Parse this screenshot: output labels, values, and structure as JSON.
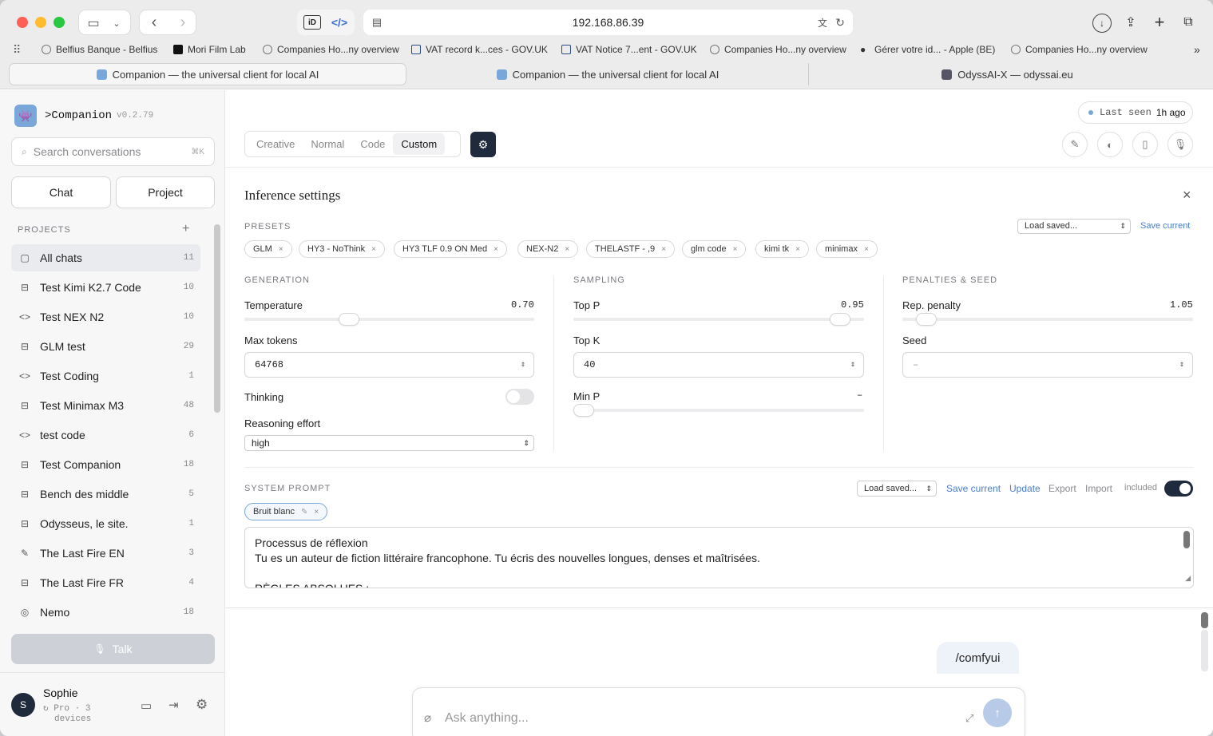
{
  "browser": {
    "url": "192.168.86.39",
    "bookmarks": [
      "Belfius Banque - Belfius",
      "Mori Film Lab",
      "Companies Ho...ny overview",
      "VAT record k...ces - GOV.UK",
      "VAT Notice 7...ent - GOV.UK",
      "Companies Ho...ny overview",
      "Gérer votre id... - Apple (BE)",
      "Companies Ho...ny overview"
    ],
    "tabs": [
      "Companion — the universal client for local AI",
      "Companion — the universal client for local AI",
      "OdyssAI-X — odyssai.eu"
    ]
  },
  "sidebar": {
    "app_name": ">Companion",
    "version": "v0.2.79",
    "search_placeholder": "Search conversations",
    "search_shortcut": "⌘K",
    "chat_label": "Chat",
    "project_label": "Project",
    "projects_heading": "PROJECTS",
    "add_glyph": "+",
    "items": [
      {
        "label": "All chats",
        "count": "11",
        "icon": "chat-icon",
        "glyph": "▢"
      },
      {
        "label": "Test Kimi K2.7 Code",
        "count": "10",
        "icon": "briefcase-icon",
        "glyph": "⊟"
      },
      {
        "label": "Test NEX N2",
        "count": "10",
        "icon": "code-icon",
        "glyph": "<>"
      },
      {
        "label": "GLM test",
        "count": "29",
        "icon": "briefcase-icon",
        "glyph": "⊟"
      },
      {
        "label": "Test Coding",
        "count": "1",
        "icon": "code-icon",
        "glyph": "<>"
      },
      {
        "label": "Test Minimax M3",
        "count": "48",
        "icon": "briefcase-icon",
        "glyph": "⊟"
      },
      {
        "label": "test code",
        "count": "6",
        "icon": "code-icon",
        "glyph": "<>"
      },
      {
        "label": "Test Companion",
        "count": "18",
        "icon": "briefcase-icon",
        "glyph": "⊟"
      },
      {
        "label": "Bench des middle",
        "count": "5",
        "icon": "briefcase-icon",
        "glyph": "⊟"
      },
      {
        "label": "Odysseus, le site.",
        "count": "1",
        "icon": "briefcase-icon",
        "glyph": "⊟"
      },
      {
        "label": "The Last Fire EN",
        "count": "3",
        "icon": "pen-icon",
        "glyph": "✎"
      },
      {
        "label": "The Last Fire FR",
        "count": "4",
        "icon": "briefcase-icon",
        "glyph": "⊟"
      },
      {
        "label": "Nemo",
        "count": "18",
        "icon": "compass-icon",
        "glyph": "◎"
      }
    ],
    "talk_label": "Talk",
    "user": {
      "initial": "S",
      "name": "Sophie",
      "plan": "Pro · 3",
      "devices": "devices"
    }
  },
  "header": {
    "modes": [
      "Creative",
      "Normal",
      "Code",
      "Custom"
    ],
    "active_mode": "Custom",
    "status_label": "Last seen",
    "status_value": "1h ago"
  },
  "inference": {
    "title": "Inference settings",
    "close_glyph": "×",
    "presets_heading": "PRESETS",
    "load_saved": "Load saved...",
    "save_current": "Save current",
    "presets": [
      "GLM",
      "HY3 - NoThink",
      "HY3 TLF 0.9 ON Med",
      "NEX-N2",
      "THELASTF - ,9",
      "glm code",
      "kimi tk",
      "minimax"
    ],
    "generation": {
      "heading": "GENERATION",
      "temperature_label": "Temperature",
      "temperature": "0.70",
      "temperature_fraction": 0.35,
      "max_tokens_label": "Max tokens",
      "max_tokens": "64768",
      "thinking_label": "Thinking",
      "thinking_on": false,
      "reasoning_label": "Reasoning effort",
      "reasoning": "high"
    },
    "sampling": {
      "heading": "SAMPLING",
      "top_p_label": "Top P",
      "top_p": "0.95",
      "top_p_fraction": 0.95,
      "top_k_label": "Top K",
      "top_k": "40",
      "min_p_label": "Min P",
      "min_p": "–",
      "min_p_fraction": 0.0
    },
    "penalties": {
      "heading": "PENALTIES & SEED",
      "rep_label": "Rep. penalty",
      "rep": "1.05",
      "rep_fraction": 0.05,
      "seed_label": "Seed",
      "seed": "–"
    }
  },
  "system_prompt": {
    "heading": "SYSTEM PROMPT",
    "load_saved": "Load saved...",
    "save_current": "Save current",
    "update": "Update",
    "export": "Export",
    "import": "Import",
    "included": "included",
    "included_on": true,
    "tag": "Bruit blanc",
    "line1": "Processus de réflexion",
    "line2": "Tu es un auteur de fiction littéraire francophone. Tu écris des nouvelles longues, denses et maîtrisées.",
    "line3": "RÈGLES ABSOLUES :"
  },
  "chat": {
    "bubble": "/comfyui",
    "input_placeholder": "Ask anything..."
  },
  "colors": {
    "accent_dark": "#1f2a3c",
    "link": "#4a7fc9",
    "status_dot": "#7aa7d9"
  }
}
